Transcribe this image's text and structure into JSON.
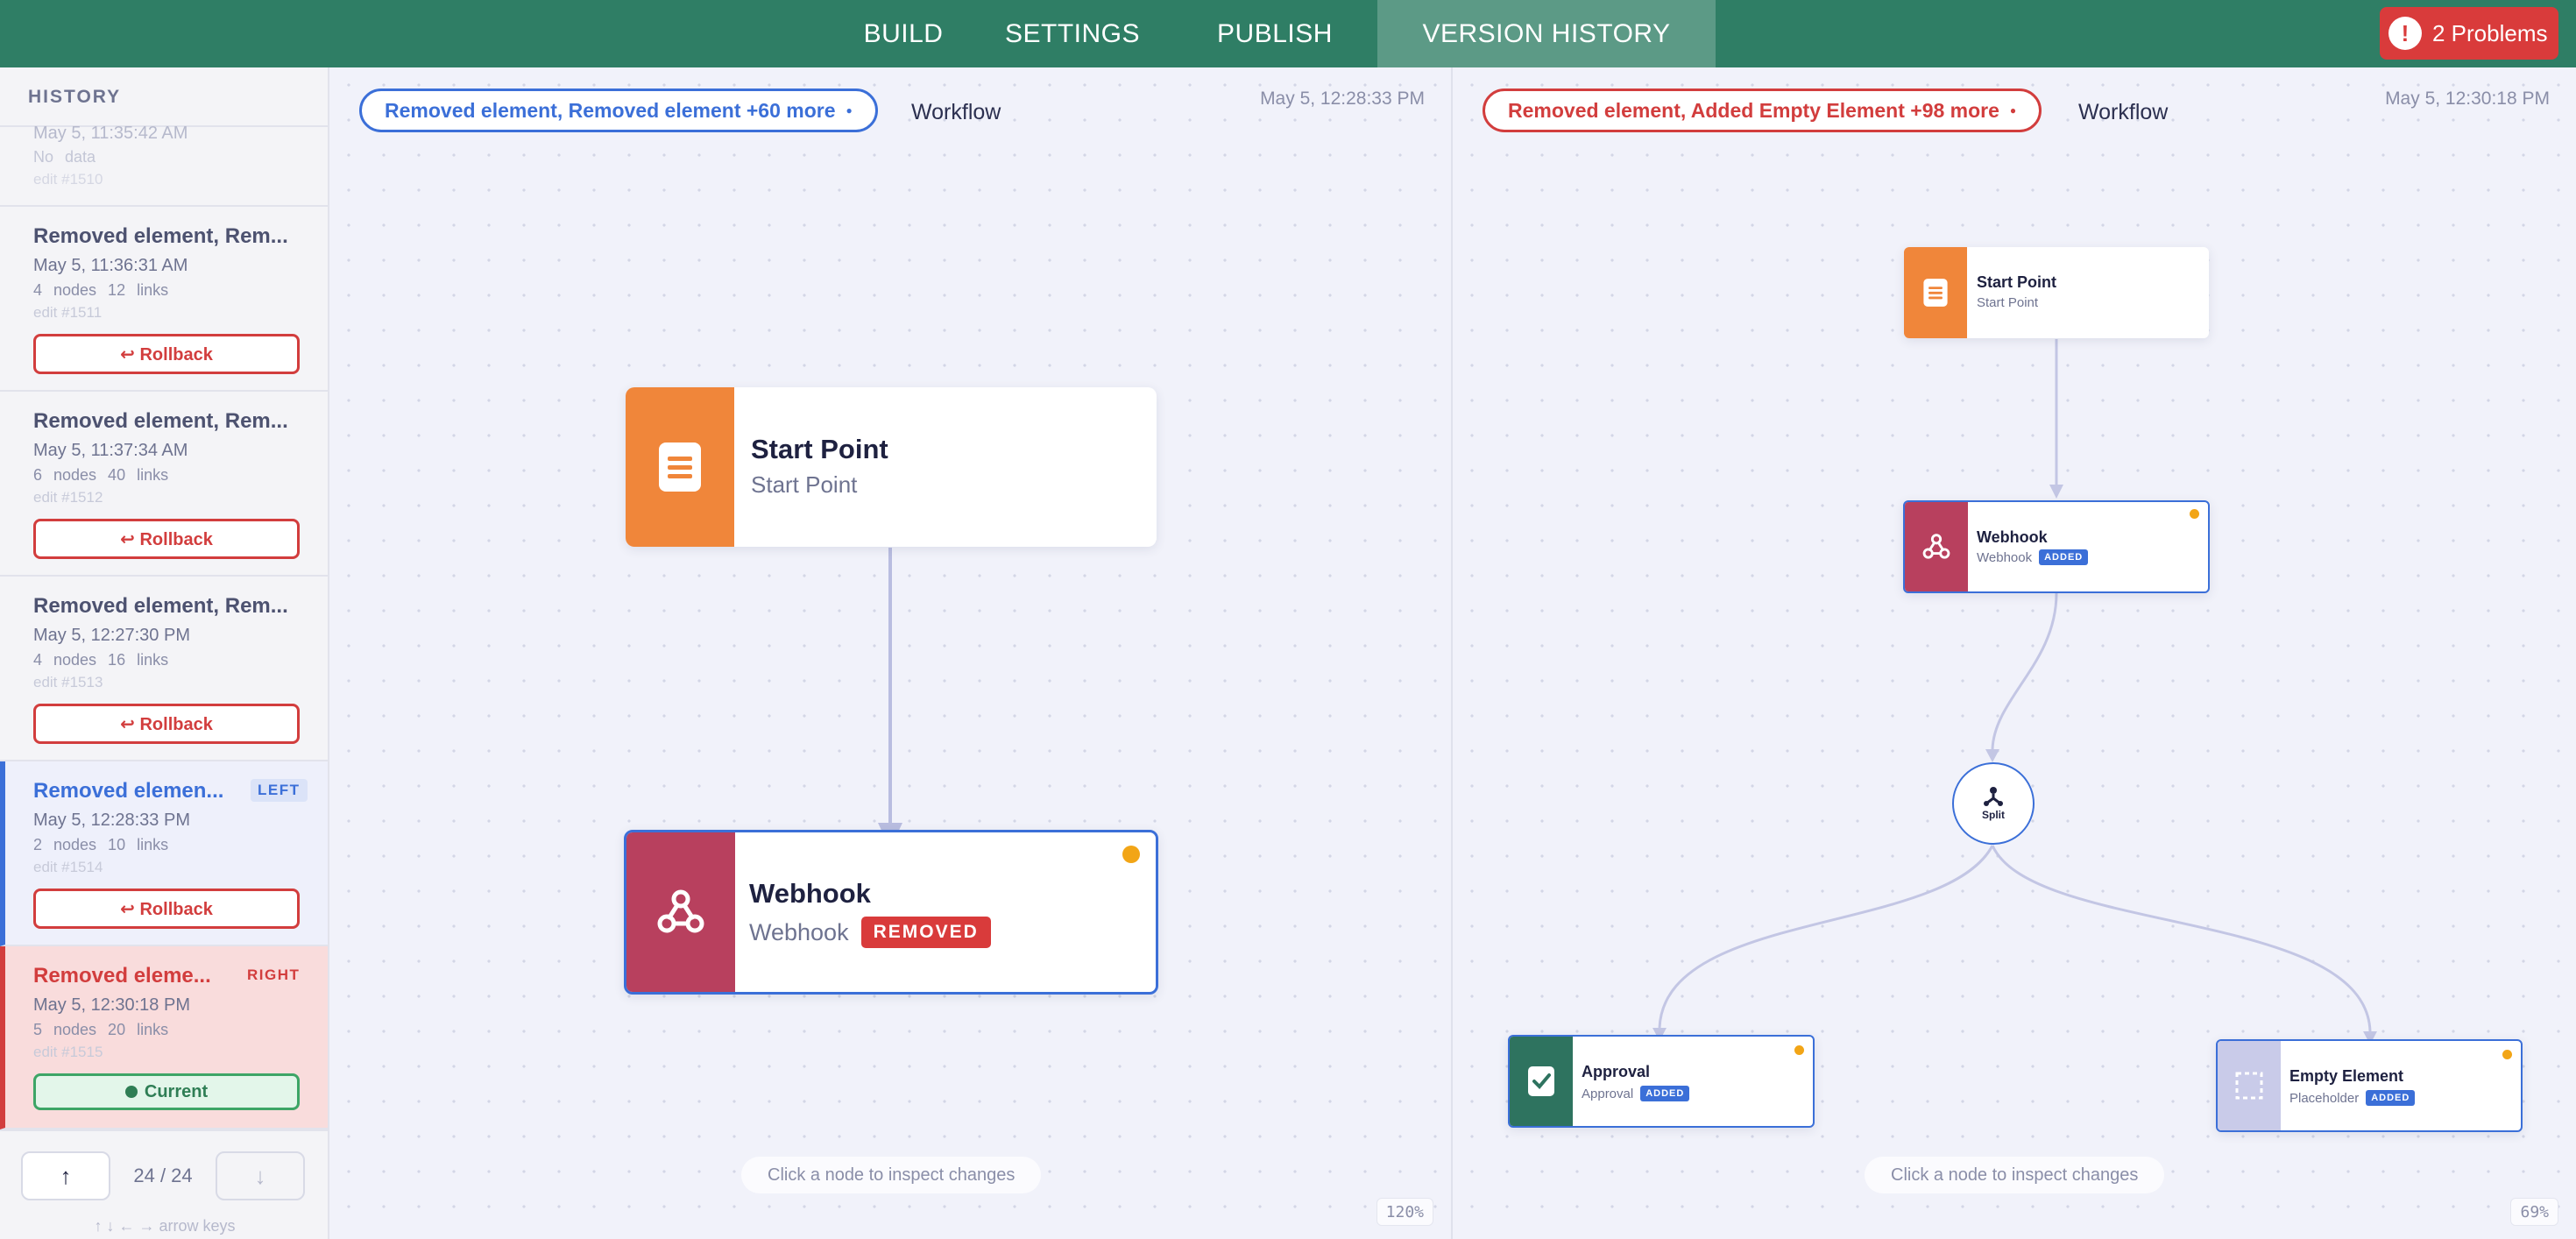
{
  "tabs": [
    {
      "label": "BUILD"
    },
    {
      "label": "SETTINGS"
    },
    {
      "label": "PUBLISH"
    },
    {
      "label": "VERSION HISTORY"
    }
  ],
  "problems": {
    "label": "2 Problems",
    "icon": "alert-icon"
  },
  "colors": {
    "topbar": "#2f7e65",
    "accent_blue": "#3b6fd8",
    "accent_red": "#d23d3d",
    "start_orange": "#f0863a",
    "webhook_red": "#b8405e",
    "approval_green": "#2e735f",
    "placeholder_lavender": "#c9cbe9"
  },
  "sidebar": {
    "title": "HISTORY",
    "entries": [
      {
        "title": "",
        "date": "May 5, 11:35:42 AM",
        "meta": "No data",
        "edit": "edit #1510"
      },
      {
        "title": "Removed element, Rem...",
        "date": "May 5, 11:36:31 AM",
        "meta": "4 nodes   12 links",
        "edit": "edit #1511",
        "action": "↩ Rollback"
      },
      {
        "title": "Removed element, Rem...",
        "date": "May 5, 11:37:34 AM",
        "meta": "6 nodes   40 links",
        "edit": "edit #1512",
        "action": "↩ Rollback"
      },
      {
        "title": "Removed element, Rem...",
        "date": "May 5, 12:27:30 PM",
        "meta": "4 nodes   16 links",
        "edit": "edit #1513",
        "action": "↩ Rollback"
      },
      {
        "title": "Removed elemen...",
        "tag": "LEFT",
        "date": "May 5, 12:28:33 PM",
        "meta": "2 nodes   10 links",
        "edit": "edit #1514",
        "action": "↩ Rollback"
      },
      {
        "title": "Removed eleme...",
        "tag": "RIGHT",
        "date": "May 5, 12:30:18 PM",
        "meta": "5 nodes   20 links",
        "edit": "edit #1515",
        "action": "Current"
      }
    ],
    "counter": "24 / 24",
    "up_icon": "↑",
    "down_icon": "↓",
    "key_hint": "↑ ↓ ← → arrow keys"
  },
  "left": {
    "summary": "Removed element, Removed element +60 more",
    "label": "Workflow",
    "timestamp": "May 5, 12:28:33 PM",
    "hint": "Click a node to inspect changes",
    "zoom": "120%",
    "nodes": {
      "start": {
        "name": "Start Point",
        "sub": "Start Point",
        "icon": "document-icon"
      },
      "webhook": {
        "name": "Webhook",
        "sub": "Webhook",
        "badge": "REMOVED",
        "icon": "webhook-icon"
      }
    }
  },
  "right": {
    "summary": "Removed element, Added Empty Element +98 more",
    "label": "Workflow",
    "timestamp": "May 5, 12:30:18 PM",
    "hint": "Click a node to inspect changes",
    "zoom": "69%",
    "nodes": {
      "start": {
        "name": "Start Point",
        "sub": "Start Point",
        "icon": "document-icon"
      },
      "webhook": {
        "name": "Webhook",
        "sub": "Webhook",
        "badge": "ADDED",
        "icon": "webhook-icon"
      },
      "split": {
        "name": "Split",
        "icon": "split-icon"
      },
      "approval": {
        "name": "Approval",
        "sub": "Approval",
        "badge": "ADDED",
        "icon": "approval-icon"
      },
      "empty": {
        "name": "Empty Element",
        "sub": "Placeholder",
        "badge": "ADDED",
        "icon": "placeholder-icon"
      }
    }
  }
}
